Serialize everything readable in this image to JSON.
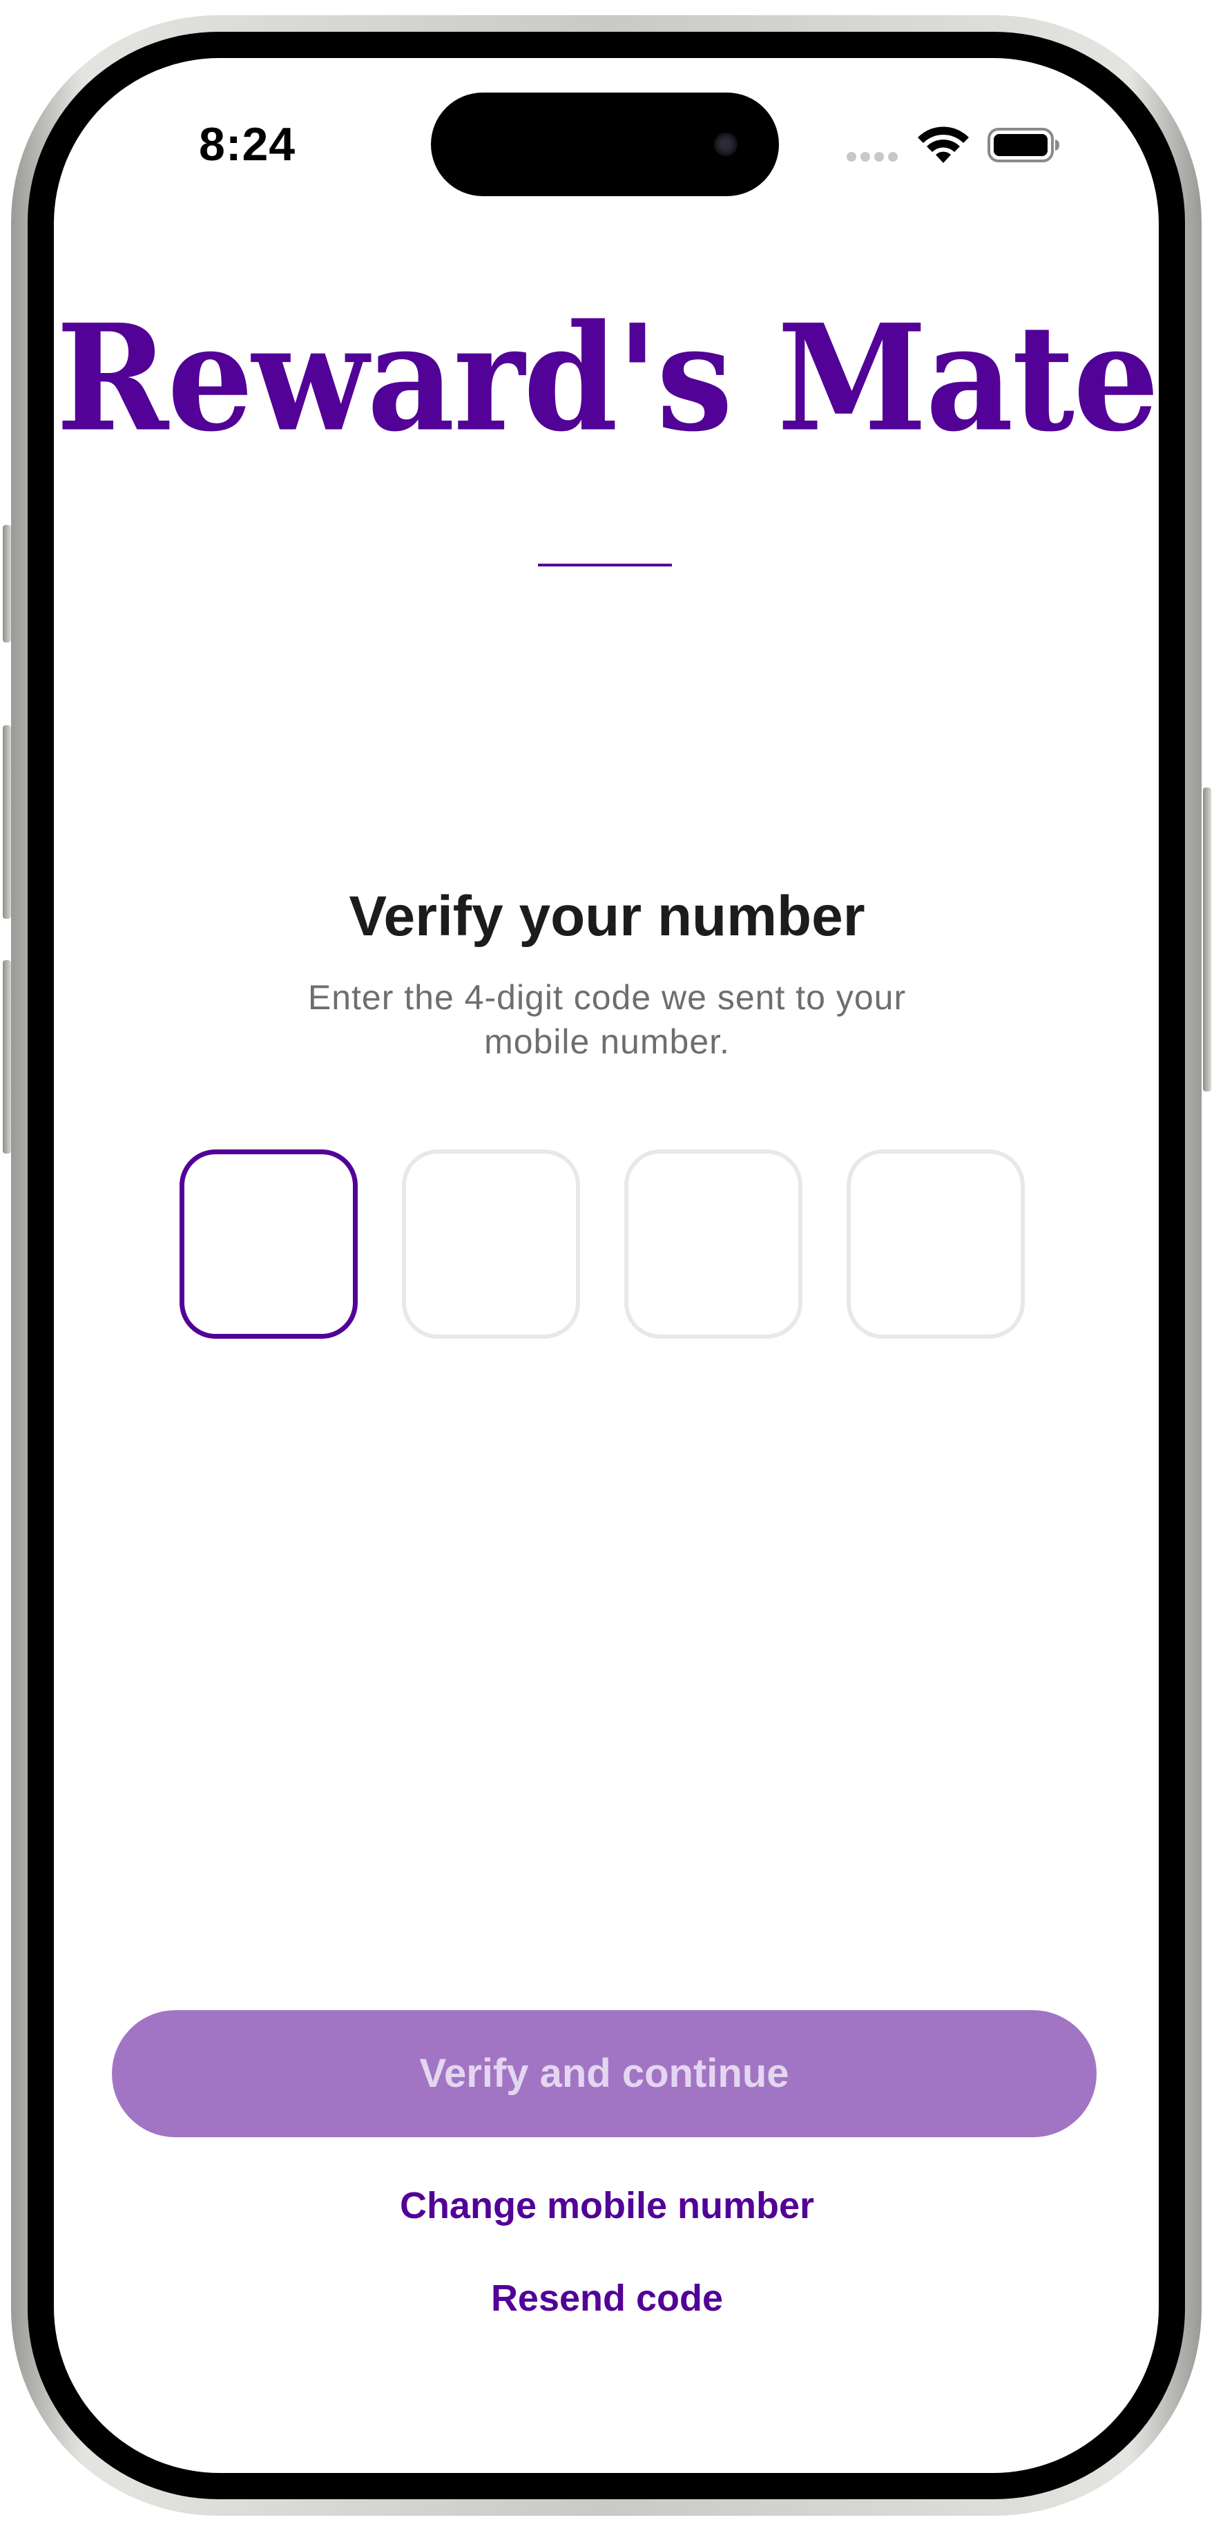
{
  "status_bar": {
    "time": "8:24",
    "wifi_icon": "wifi-icon",
    "battery_icon": "battery-icon"
  },
  "app": {
    "title": "Reward's Mate",
    "brand_color": "#520296"
  },
  "verify": {
    "heading": "Verify your number",
    "subtitle": "Enter the 4-digit code we sent to your mobile number.",
    "code_digits": [
      "",
      "",
      "",
      ""
    ],
    "active_index": 0
  },
  "actions": {
    "verify_button": "Verify and continue",
    "verify_button_color": "#a175c4",
    "change_number": "Change mobile number",
    "resend_code": "Resend code"
  }
}
